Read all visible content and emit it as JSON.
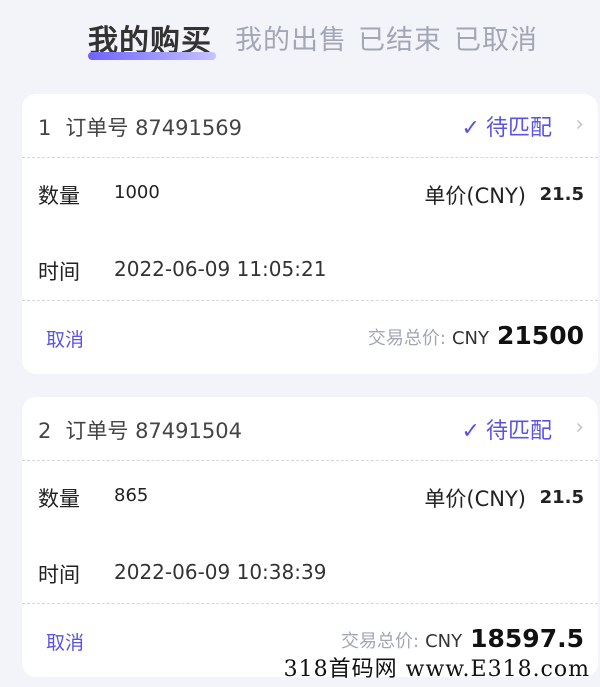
{
  "tabs": [
    {
      "label": "我的购买",
      "active": true
    },
    {
      "label": "我的出售",
      "active": false
    },
    {
      "label": "已结束",
      "active": false
    },
    {
      "label": "已取消",
      "active": false
    }
  ],
  "colors": {
    "accent": "#5a54e0",
    "muted": "#a3a6b4",
    "background": "#f3f4f9"
  },
  "orders": [
    {
      "index": "1",
      "order_label": "订单号",
      "order_number": "87491569",
      "status": "待匹配",
      "status_icon": "check-icon",
      "quantity_label": "数量",
      "quantity": "1000",
      "unit_price_label": "单价(CNY)",
      "unit_price": "21.5",
      "time_label": "时间",
      "time": "2022-06-09 11:05:21",
      "cancel_label": "取消",
      "total_label": "交易总价:",
      "currency": "CNY",
      "total": "21500"
    },
    {
      "index": "2",
      "order_label": "订单号",
      "order_number": "87491504",
      "status": "待匹配",
      "status_icon": "check-icon",
      "quantity_label": "数量",
      "quantity": "865",
      "unit_price_label": "单价(CNY)",
      "unit_price": "21.5",
      "time_label": "时间",
      "time": "2022-06-09 10:38:39",
      "cancel_label": "取消",
      "total_label": "交易总价:",
      "currency": "CNY",
      "total": "18597.5"
    }
  ],
  "watermark": "318首码网 www.E318.com"
}
